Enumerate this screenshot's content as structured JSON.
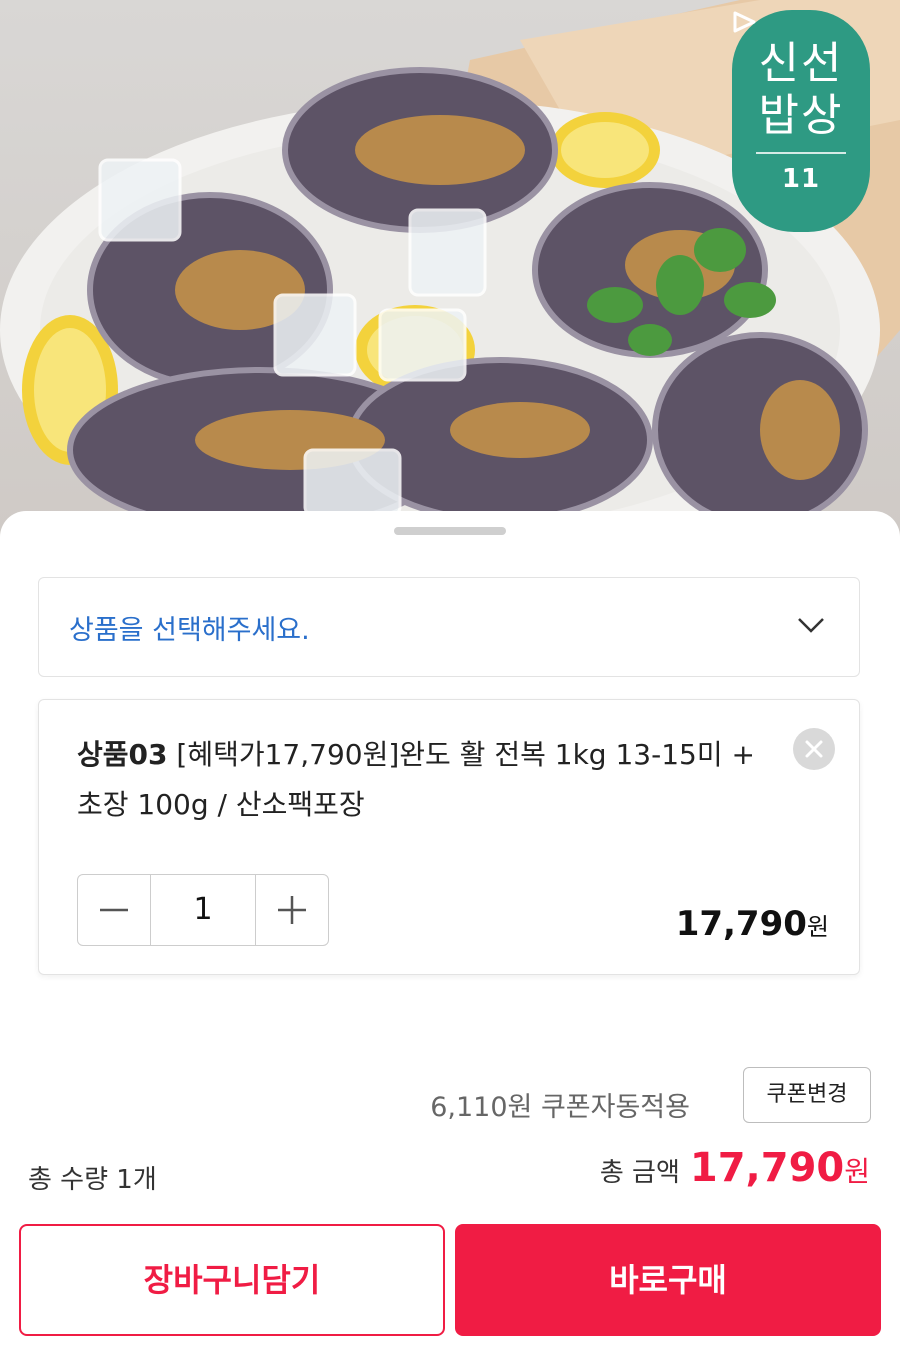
{
  "badge": {
    "title": "신선\n밥상",
    "mark": "11"
  },
  "select": {
    "placeholder": "상품을 선택해주세요."
  },
  "item": {
    "code": "상품03",
    "name": " [혜택가17,790원]완도 활 전복 1kg 13-15미 + 초장 100g / 산소팩포장",
    "quantity": "1",
    "price": "17,790",
    "currency": "원"
  },
  "coupon": {
    "text": "6,110원 쿠폰자동적용",
    "button": "쿠폰변경"
  },
  "totals": {
    "qty_label": "총 수량 1개",
    "amount_label": "총 금액",
    "amount": "17,790",
    "currency": "원"
  },
  "actions": {
    "cart": "장바구니담기",
    "buy": "바로구매"
  },
  "colors": {
    "accent": "#f01c44",
    "link": "#2a6fcb",
    "badge": "#2e9a83"
  }
}
